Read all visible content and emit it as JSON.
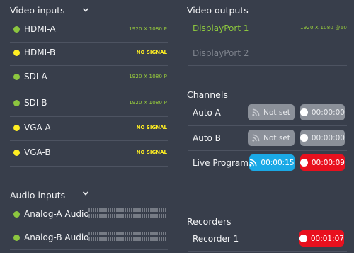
{
  "video_inputs": {
    "title": "Video inputs",
    "items": [
      {
        "label": "HDMI-A",
        "status": "1920 X 1080 P",
        "state": "ok"
      },
      {
        "label": "HDMI-B",
        "status": "NO SIGNAL",
        "state": "nosignal"
      },
      {
        "label": "SDI-A",
        "status": "1920 X 1080 P",
        "state": "ok"
      },
      {
        "label": "SDI-B",
        "status": "1920 X 1080 P",
        "state": "ok"
      },
      {
        "label": "VGA-A",
        "status": "NO SIGNAL",
        "state": "nosignal"
      },
      {
        "label": "VGA-B",
        "status": "NO SIGNAL",
        "state": "nosignal"
      }
    ]
  },
  "audio_inputs": {
    "title": "Audio inputs",
    "items": [
      {
        "label": "Analog-A Audio"
      },
      {
        "label": "Analog-B Audio"
      }
    ]
  },
  "video_outputs": {
    "title": "Video outputs",
    "items": [
      {
        "label": "DisplayPort 1",
        "status": "1920 X 1080 @60",
        "active": true
      },
      {
        "label": "DisplayPort 2",
        "status": "",
        "active": false
      }
    ]
  },
  "channels": {
    "title": "Channels",
    "items": [
      {
        "label": "Auto A",
        "stream": "Not set",
        "record": "00:00:00"
      },
      {
        "label": "Auto B",
        "stream": "Not set",
        "record": "00:00:00"
      },
      {
        "label": "Live Program",
        "stream": "00:00:15",
        "record": "00:00:09"
      }
    ]
  },
  "recorders": {
    "title": "Recorders",
    "items": [
      {
        "label": "Recorder 1",
        "record": "00:01:07"
      }
    ]
  },
  "colors": {
    "background": "#383e4b",
    "ok": "#8cc63f",
    "nosignal": "#ffee22",
    "active_output": "#8cc63f",
    "inactive_output": "#7e838d",
    "streaming": "#1aa9e6",
    "recording": "#e8101e",
    "idle": "#8b9099"
  }
}
